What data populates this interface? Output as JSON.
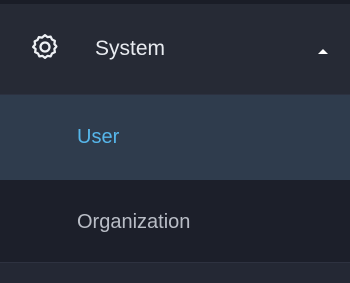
{
  "menu": {
    "group": {
      "label": "System",
      "icon": "gear-icon",
      "expanded": true,
      "caret_icon": "chevron-up-icon"
    },
    "items": [
      {
        "label": "User",
        "active": true
      },
      {
        "label": "Organization",
        "active": false
      }
    ]
  },
  "colors": {
    "header_bg": "#262a35",
    "active_bg": "#2f3c4d",
    "active_text": "#56b6ea",
    "inactive_text": "#b9bdc6",
    "header_text": "#e8ebf0"
  }
}
